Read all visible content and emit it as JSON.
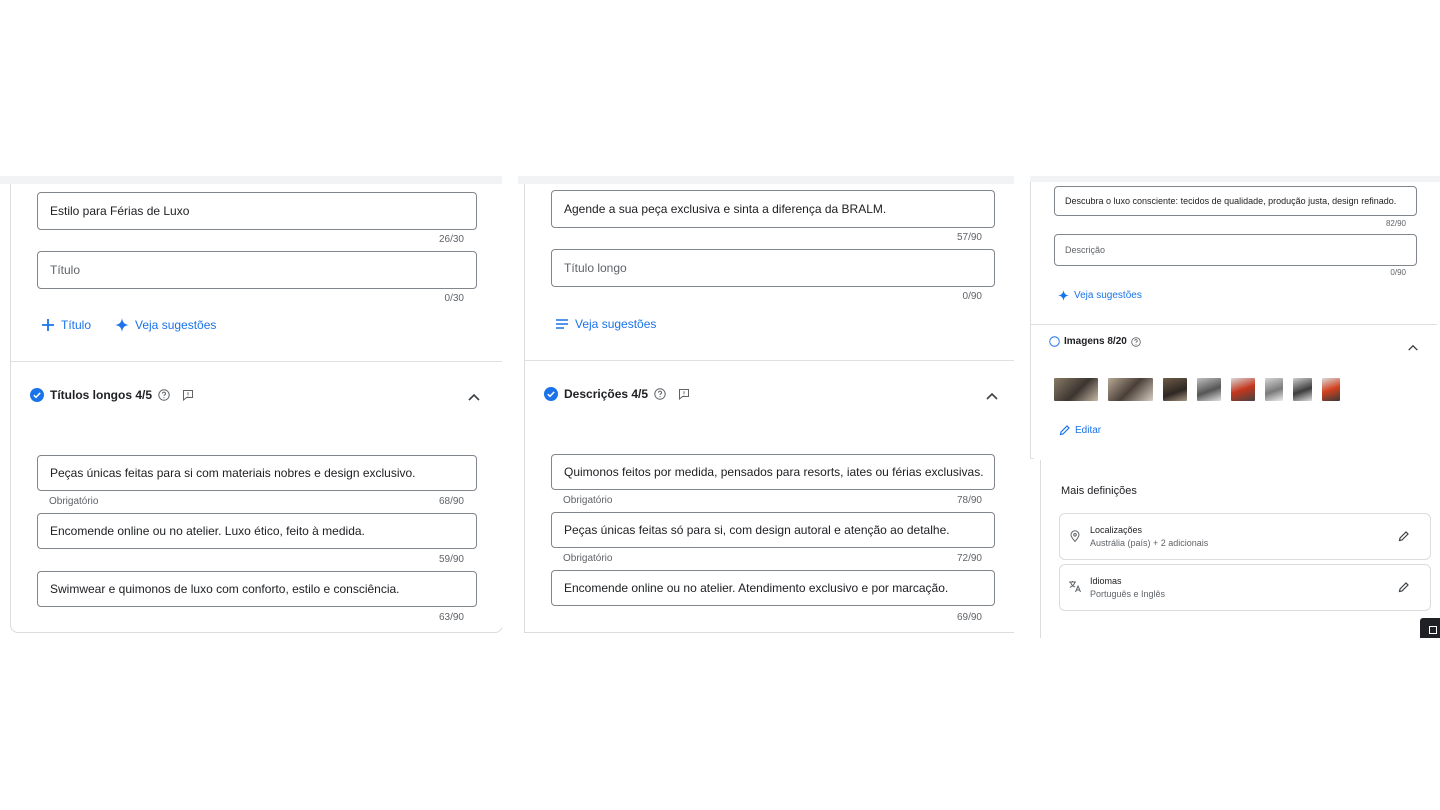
{
  "panel1": {
    "field_title_value": "Estilo para Férias de Luxo",
    "counter_title_value": "26/30",
    "field_title_placeholder": "Título",
    "counter_title_empty": "0/30",
    "add_title_label": "Título",
    "suggestions_label": "Veja sugestões",
    "section_title": "Títulos longos 4/5",
    "long_titles": [
      {
        "text": "Peças únicas feitas para si com materiais nobres e design exclusivo.",
        "required": "Obrigatório",
        "counter": "68/90"
      },
      {
        "text": "Encomende online ou no atelier. Luxo ético, feito à medida.",
        "required": "",
        "counter": "59/90"
      },
      {
        "text": "Swimwear e quimonos de luxo com conforto, estilo e consciência.",
        "required": "",
        "counter": "63/90"
      }
    ]
  },
  "panel2": {
    "field_value": "Agende a sua peça exclusiva e sinta a diferença da BRALM.",
    "counter_value": "57/90",
    "field_placeholder": "Título longo",
    "counter_empty": "0/90",
    "suggestions_label": "Veja sugestões",
    "section_title": "Descrições 4/5",
    "descriptions": [
      {
        "text": "Quimonos feitos por medida, pensados para resorts, iates ou férias exclusivas.",
        "required": "Obrigatório",
        "counter": "78/90"
      },
      {
        "text": "Peças únicas feitas só para si, com design autoral e atenção ao detalhe.",
        "required": "Obrigatório",
        "counter": "72/90"
      },
      {
        "text": "Encomende online ou no atelier. Atendimento exclusivo e por marcação.",
        "required": "",
        "counter": "69/90"
      }
    ]
  },
  "panel3": {
    "field_value": "Descubra o luxo consciente: tecidos de qualidade, produção justa, design refinado.",
    "counter_value": "82/90",
    "field_placeholder": "Descrição",
    "counter_empty": "0/90",
    "suggestions_label": "Veja sugestões",
    "images_title": "Imagens 8/20",
    "edit_label": "Editar",
    "more_settings_title": "Mais definições",
    "locations_title": "Localizações",
    "locations_value": "Austrália (país) + 2 adicionais",
    "languages_title": "Idiomas",
    "languages_value": "Português e Inglês"
  },
  "colors": {
    "accent": "#1a73e8",
    "border": "#80868b",
    "muted": "#5f6368",
    "divider": "#e0e0e0"
  }
}
